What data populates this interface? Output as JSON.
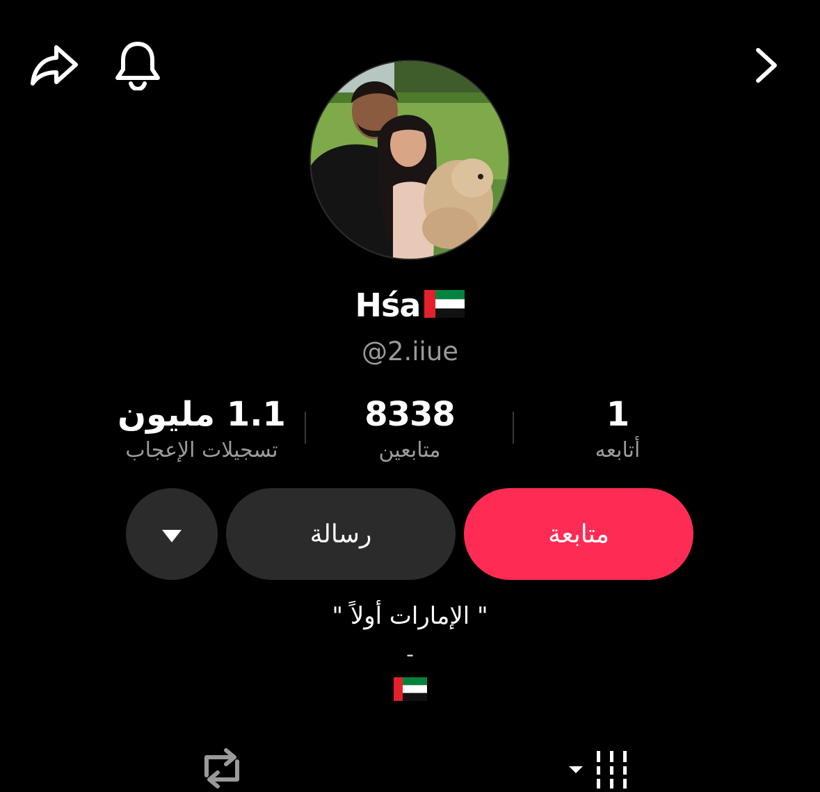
{
  "header": {
    "share_icon": "share-icon",
    "bell_icon": "bell-icon",
    "next_icon": "chevron-right-icon"
  },
  "profile": {
    "display_name": "Hśa",
    "display_name_flag": "uae-flag",
    "handle": "@2.iiue"
  },
  "stats": {
    "likes_value": "1.1 مليون",
    "likes_label": "تسجيلات الإعجاب",
    "followers_value": "8338",
    "followers_label": "متابعين",
    "following_value": "1",
    "following_label": "أتابعه"
  },
  "actions": {
    "follow_label": "متابعة",
    "message_label": "رسالة",
    "more_icon": "caret-down-icon"
  },
  "bio": {
    "line1": "\" الإمارات أولاً \"",
    "line2": "-",
    "flag": "uae-flag"
  },
  "tabs": {
    "repost_icon": "repost-icon",
    "videos_icon": "grid-bars-icon"
  },
  "colors": {
    "background": "#000000",
    "follow_button": "#fe2c55",
    "secondary_button": "#2b2b2b",
    "muted_text": "#9c9c9c"
  }
}
